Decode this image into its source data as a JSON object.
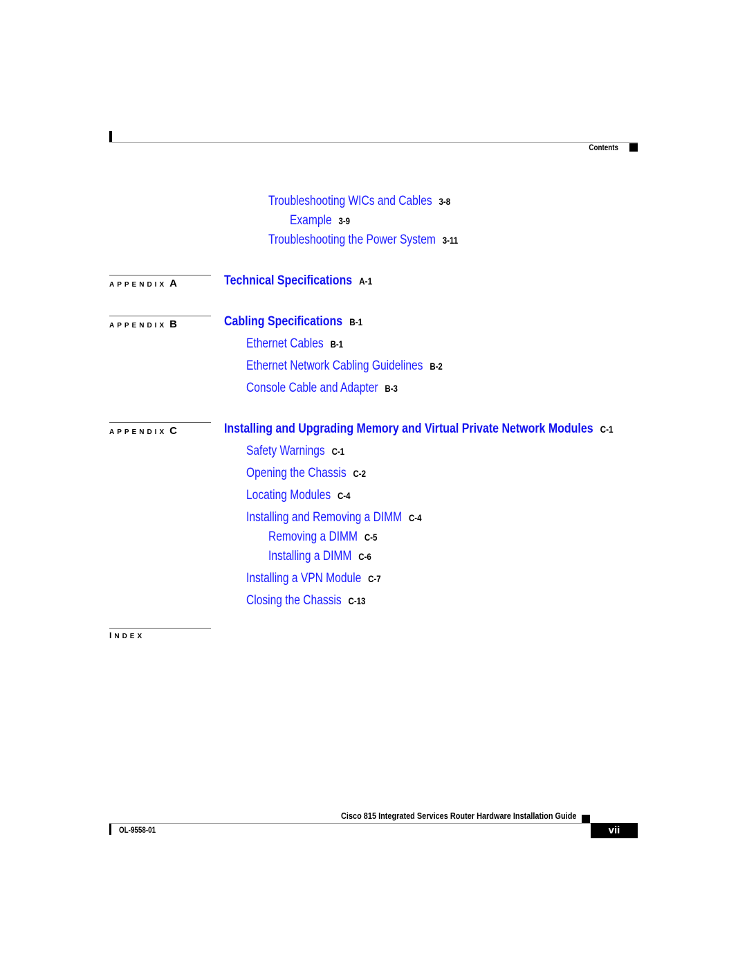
{
  "header": {
    "section_label": "Contents"
  },
  "toc": {
    "chapter3_tail": [
      {
        "title": "Troubleshooting WICs and Cables",
        "page": "3-8",
        "level": 2
      },
      {
        "title": "Example",
        "page": "3-9",
        "level": 3
      },
      {
        "title": "Troubleshooting the Power System",
        "page": "3-11",
        "level": 2
      }
    ],
    "appendix_a": {
      "label": "APPENDIX",
      "letter": "A",
      "title": "Technical Specifications",
      "page": "A-1",
      "entries": []
    },
    "appendix_b": {
      "label": "APPENDIX",
      "letter": "B",
      "title": "Cabling Specifications",
      "page": "B-1",
      "entries": [
        {
          "title": "Ethernet Cables",
          "page": "B-1",
          "level": 1
        },
        {
          "title": "Ethernet Network Cabling Guidelines",
          "page": "B-2",
          "level": 1
        },
        {
          "title": "Console Cable and Adapter",
          "page": "B-3",
          "level": 1
        }
      ]
    },
    "appendix_c": {
      "label": "APPENDIX",
      "letter": "C",
      "title": "Installing and Upgrading Memory and Virtual Private Network Modules",
      "page": "C-1",
      "entries": [
        {
          "title": "Safety Warnings",
          "page": "C-1",
          "level": 1
        },
        {
          "title": "Opening the Chassis",
          "page": "C-2",
          "level": 1
        },
        {
          "title": "Locating Modules",
          "page": "C-4",
          "level": 1
        },
        {
          "title": "Installing and Removing a DIMM",
          "page": "C-4",
          "level": 1
        },
        {
          "title": "Removing a DIMM",
          "page": "C-5",
          "level": 2
        },
        {
          "title": "Installing a DIMM",
          "page": "C-6",
          "level": 2
        },
        {
          "title": "Installing a VPN Module",
          "page": "C-7",
          "level": 1
        },
        {
          "title": "Closing the Chassis",
          "page": "C-13",
          "level": 1
        }
      ]
    },
    "index": {
      "label_first": "I",
      "label_rest": "NDEX"
    }
  },
  "footer": {
    "guide_title": "Cisco 815 Integrated Services Router Hardware Installation Guide",
    "doc_number": "OL-9558-01",
    "page_number": "vii"
  },
  "colors": {
    "link_blue": "#1a1aff",
    "text": "#000000"
  }
}
